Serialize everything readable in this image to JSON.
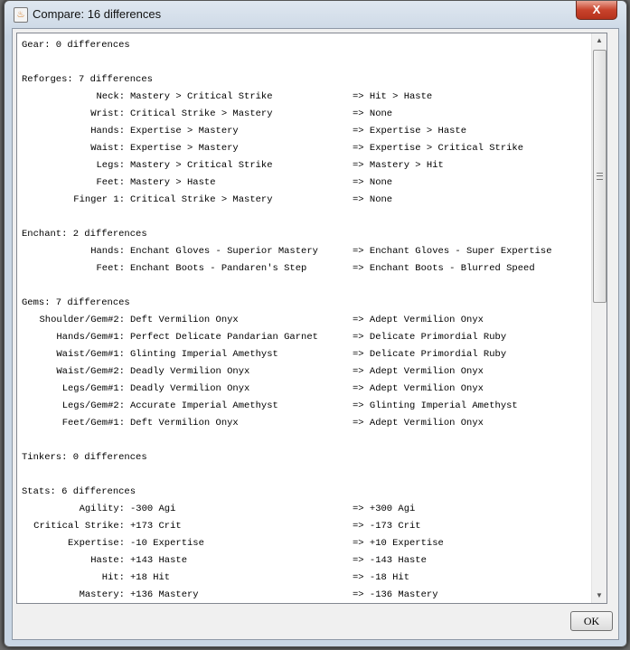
{
  "window": {
    "title": "Compare: 16 differences",
    "close_label": "X",
    "ok_label": "OK"
  },
  "lines": [
    {
      "h": "Gear: 0 differences"
    },
    {
      "blank": true
    },
    {
      "h": "Reforges: 7 differences"
    },
    {
      "l": "Neck:",
      "v": "Mastery > Critical Strike",
      "a": "=> Hit > Haste"
    },
    {
      "l": "Wrist:",
      "v": "Critical Strike > Mastery",
      "a": "=> None"
    },
    {
      "l": "Hands:",
      "v": "Expertise > Mastery",
      "a": "=> Expertise > Haste"
    },
    {
      "l": "Waist:",
      "v": "Expertise > Mastery",
      "a": "=> Expertise > Critical Strike"
    },
    {
      "l": "Legs:",
      "v": "Mastery > Critical Strike",
      "a": "=> Mastery > Hit"
    },
    {
      "l": "Feet:",
      "v": "Mastery > Haste",
      "a": "=> None"
    },
    {
      "l": "Finger 1:",
      "v": "Critical Strike > Mastery",
      "a": "=> None"
    },
    {
      "blank": true
    },
    {
      "h": "Enchant: 2 differences"
    },
    {
      "l": "Hands:",
      "v": "Enchant Gloves - Superior Mastery",
      "a": "=> Enchant Gloves - Super Expertise"
    },
    {
      "l": "Feet:",
      "v": "Enchant Boots - Pandaren's Step",
      "a": "=> Enchant Boots - Blurred Speed"
    },
    {
      "blank": true
    },
    {
      "h": "Gems: 7 differences"
    },
    {
      "l": "Shoulder/Gem#2:",
      "v": "Deft Vermilion Onyx",
      "a": "=> Adept Vermilion Onyx"
    },
    {
      "l": "Hands/Gem#1:",
      "v": "Perfect Delicate Pandarian Garnet",
      "a": "=> Delicate Primordial Ruby"
    },
    {
      "l": "Waist/Gem#1:",
      "v": "Glinting Imperial Amethyst",
      "a": "=> Delicate Primordial Ruby"
    },
    {
      "l": "Waist/Gem#2:",
      "v": "Deadly Vermilion Onyx",
      "a": "=> Adept Vermilion Onyx"
    },
    {
      "l": "Legs/Gem#1:",
      "v": "Deadly Vermilion Onyx",
      "a": "=> Adept Vermilion Onyx"
    },
    {
      "l": "Legs/Gem#2:",
      "v": "Accurate Imperial Amethyst",
      "a": "=> Glinting Imperial Amethyst"
    },
    {
      "l": "Feet/Gem#1:",
      "v": "Deft Vermilion Onyx",
      "a": "=> Adept Vermilion Onyx"
    },
    {
      "blank": true
    },
    {
      "h": "Tinkers: 0 differences"
    },
    {
      "blank": true
    },
    {
      "h": "Stats: 6 differences"
    },
    {
      "l": "Agility:",
      "v": "-300 Agi",
      "a": "=> +300 Agi"
    },
    {
      "l": "Critical Strike:",
      "v": "+173 Crit",
      "a": "=> -173 Crit"
    },
    {
      "l": "Expertise:",
      "v": "-10 Expertise",
      "a": "=> +10 Expertise"
    },
    {
      "l": "Haste:",
      "v": "+143 Haste",
      "a": "=> -143 Haste"
    },
    {
      "l": "Hit:",
      "v": "+18 Hit",
      "a": "=> -18 Hit"
    },
    {
      "l": "Mastery:",
      "v": "+136 Mastery",
      "a": "=> -136 Mastery"
    }
  ]
}
